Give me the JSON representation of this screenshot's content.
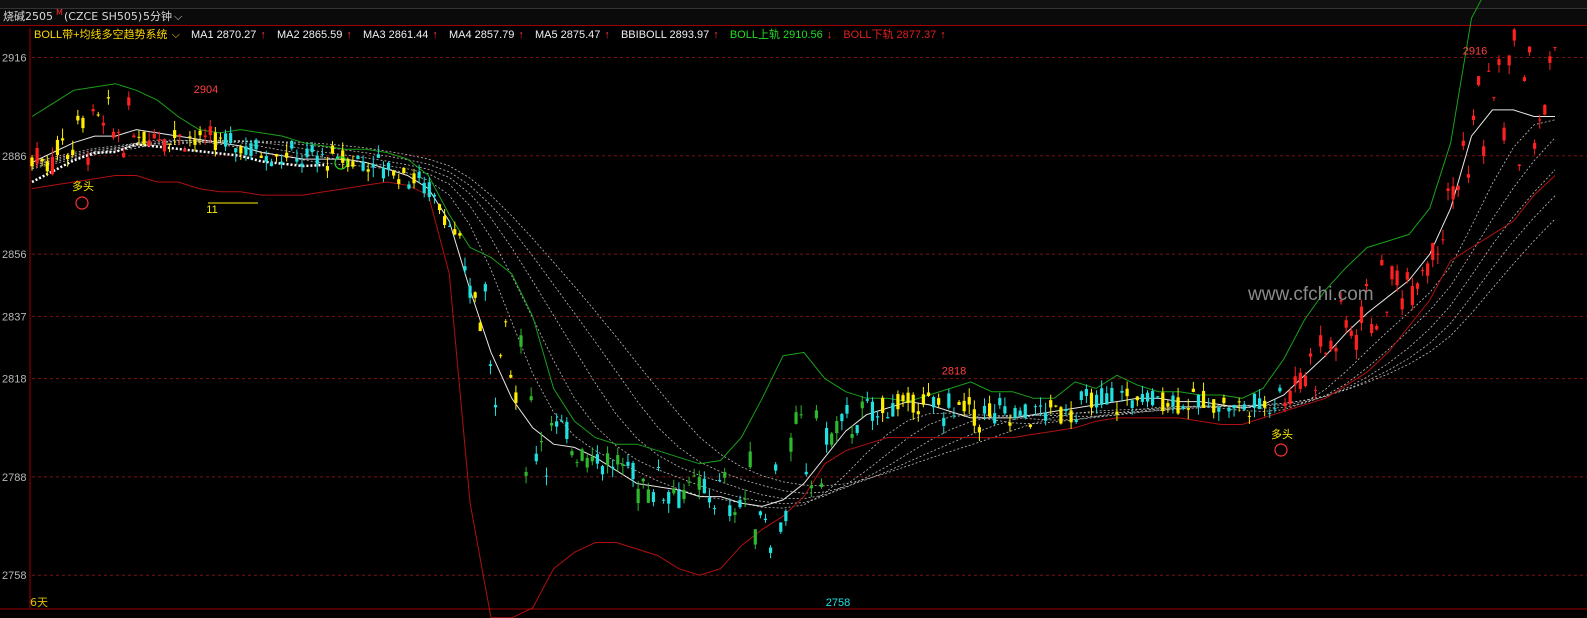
{
  "header": {
    "instrument": "烧碱2505",
    "superscript": "M",
    "exchange": "(CZCE SH505)",
    "period": "5分钟"
  },
  "indicator": {
    "name": "BOLL带+均线多空趋势系统",
    "ma1": "MA1 2870.27",
    "ma2": "MA2 2865.59",
    "ma3": "MA3 2861.44",
    "ma4": "MA4 2857.79",
    "ma5": "MA5 2875.47",
    "bbiboll": "BBIBOLL 2893.97",
    "boll_up": "BOLL上轨 2910.56",
    "boll_down": "BOLL下轨 2877.37",
    "up_arrow": "↑",
    "down_arrow": "↓"
  },
  "colors": {
    "up_candle": "#ff2020",
    "down_candle": "#20e0e0",
    "yellow_candle": "#ffee00",
    "green_candle": "#2db82d",
    "boll_upper": "#1aa01a",
    "boll_lower": "#b01010",
    "mid_line": "#e8e8e8",
    "grid": "#7a1010"
  },
  "chart_data": {
    "type": "candlestick",
    "ylim": [
      2748,
      2925
    ],
    "yticks": [
      2758,
      2788,
      2818,
      2837,
      2856,
      2886,
      2916
    ],
    "ytick_labels": [
      "2758",
      "2788",
      "2818",
      "2837",
      "2856",
      "2886",
      "2916"
    ],
    "annotations": [
      {
        "text": "2904",
        "value": 2904,
        "kind": "high"
      },
      {
        "text": "2916",
        "value": 2916,
        "kind": "high"
      },
      {
        "text": "2818",
        "value": 2818,
        "kind": "high"
      },
      {
        "text": "2758",
        "value": 2758,
        "kind": "low"
      },
      {
        "text": "多头",
        "kind": "signal"
      },
      {
        "text": "多头",
        "kind": "signal"
      },
      {
        "text": "11",
        "kind": "label"
      }
    ],
    "period_label": "6天",
    "mid_line": [
      2884,
      2887,
      2890,
      2892,
      2892,
      2894,
      2893,
      2892,
      2891,
      2890,
      2889,
      2887,
      2886,
      2885,
      2885,
      2885,
      2884,
      2882,
      2880,
      2876,
      2866,
      2845,
      2826,
      2812,
      2803,
      2798,
      2797,
      2794,
      2790,
      2786,
      2785,
      2784,
      2782,
      2782,
      2780,
      2779,
      2781,
      2786,
      2794,
      2802,
      2807,
      2809,
      2811,
      2810,
      2808,
      2806,
      2806,
      2806,
      2807,
      2808,
      2809,
      2810,
      2811,
      2812,
      2812,
      2811,
      2811,
      2810,
      2809,
      2810,
      2813,
      2819,
      2825,
      2832,
      2838,
      2843,
      2848,
      2856,
      2870,
      2892,
      2900,
      2900,
      2898,
      2898
    ],
    "boll_upper": [
      2898,
      2902,
      2906,
      2907,
      2908,
      2906,
      2903,
      2898,
      2894,
      2893,
      2894,
      2893,
      2892,
      2890,
      2889,
      2888,
      2888,
      2887,
      2885,
      2880,
      2868,
      2858,
      2855,
      2850,
      2837,
      2815,
      2805,
      2800,
      2798,
      2798,
      2796,
      2794,
      2792,
      2793,
      2800,
      2812,
      2825,
      2826,
      2818,
      2814,
      2812,
      2812,
      2811,
      2813,
      2815,
      2817,
      2814,
      2814,
      2812,
      2812,
      2817,
      2815,
      2819,
      2816,
      2814,
      2814,
      2813,
      2813,
      2812,
      2815,
      2824,
      2836,
      2845,
      2852,
      2858,
      2860,
      2862,
      2870,
      2890,
      2928,
      2940,
      2940,
      2940,
      2940
    ],
    "boll_lower": [
      2876,
      2877,
      2878,
      2879,
      2880,
      2880,
      2878,
      2878,
      2876,
      2875,
      2875,
      2874,
      2874,
      2874,
      2875,
      2876,
      2877,
      2878,
      2877,
      2874,
      2850,
      2780,
      2745,
      2745,
      2748,
      2760,
      2765,
      2768,
      2768,
      2766,
      2764,
      2760,
      2758,
      2760,
      2767,
      2772,
      2776,
      2782,
      2792,
      2796,
      2798,
      2800,
      2800,
      2800,
      2800,
      2800,
      2800,
      2800,
      2801,
      2802,
      2803,
      2805,
      2806,
      2806,
      2806,
      2806,
      2805,
      2804,
      2804,
      2806,
      2808,
      2810,
      2812,
      2816,
      2820,
      2826,
      2834,
      2842,
      2854,
      2858,
      2862,
      2866,
      2874,
      2880
    ]
  }
}
